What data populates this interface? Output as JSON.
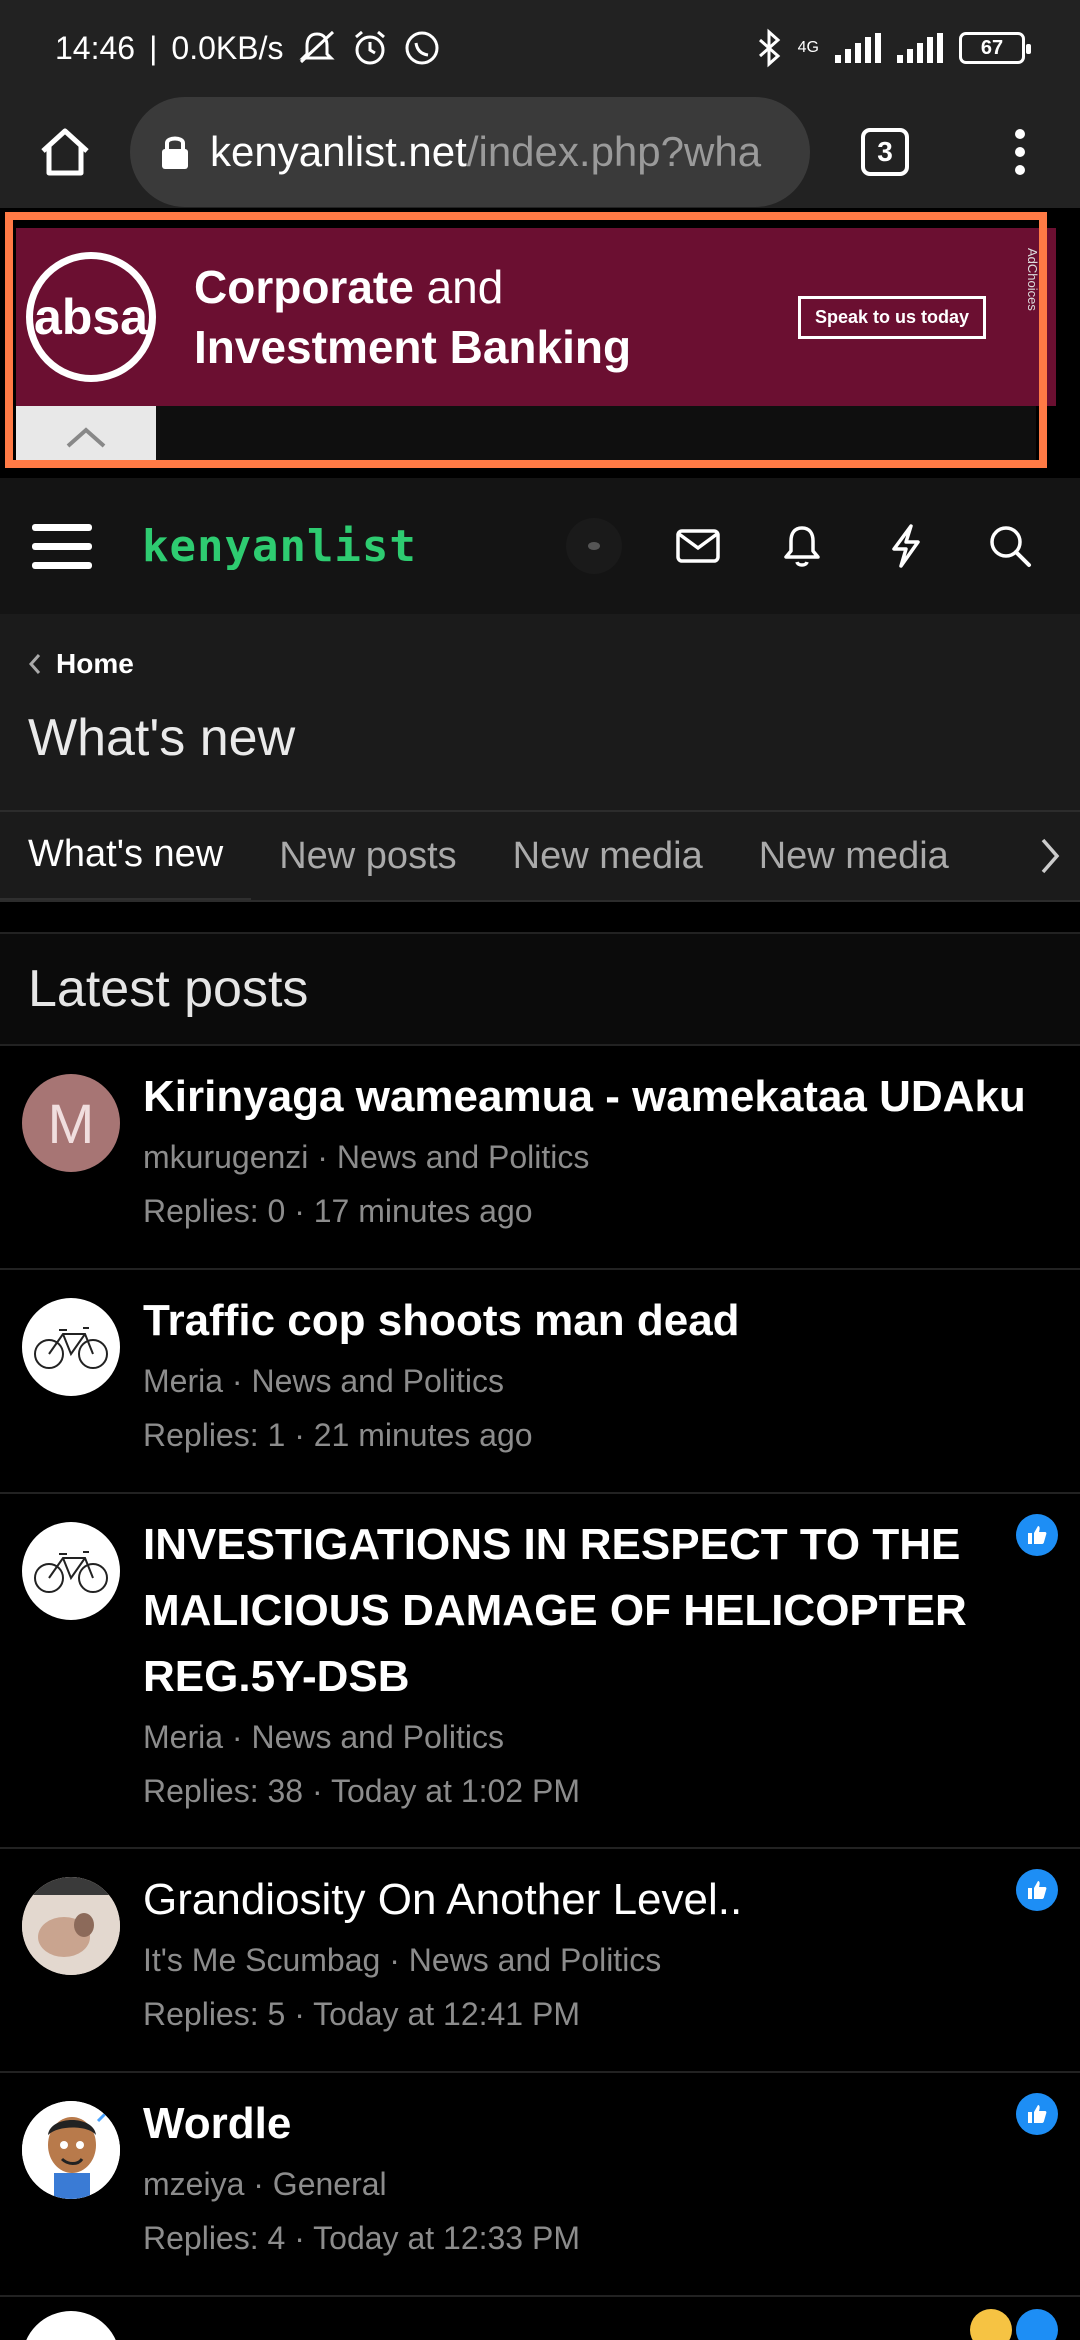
{
  "status_bar": {
    "time": "14:46",
    "speed": "0.0KB/s",
    "network": "4G",
    "battery": "67"
  },
  "browser": {
    "url_host": "kenyanlist.net",
    "url_path": "/index.php?wha",
    "tab_count": "3"
  },
  "ad": {
    "brand": "absa",
    "line1_bold": "Corporate",
    "line1_light": " and",
    "line2": "Investment Banking",
    "cta": "Speak to us today",
    "tag": "AdChoices"
  },
  "site": {
    "logo": "kenyanlist"
  },
  "breadcrumb": {
    "home": "Home"
  },
  "page_title": "What's new",
  "tabs": [
    "What's new",
    "New posts",
    "New media",
    "New media"
  ],
  "section_title": "Latest posts",
  "posts": [
    {
      "title": "Kirinyaga wameamua - wamekataa UDAku",
      "author": "mkurugenzi",
      "forum": "News and Politics",
      "replies": "Replies: 0",
      "time": "17 minutes ago",
      "avatar_letter": "M"
    },
    {
      "title": "Traffic cop shoots man dead",
      "author": "Meria",
      "forum": "News and Politics",
      "replies": "Replies: 1",
      "time": "21 minutes ago"
    },
    {
      "title": "INVESTIGATIONS IN RESPECT TO THE MALICIOUS DAMAGE OF HELICOPTER REG.5Y-DSB",
      "author": "Meria",
      "forum": "News and Politics",
      "replies": "Replies: 38",
      "time": "Today at 1:02 PM"
    },
    {
      "title": "Grandiosity On Another Level..",
      "author": "It's Me Scumbag",
      "forum": "News and Politics",
      "replies": "Replies: 5",
      "time": "Today at 12:41 PM"
    },
    {
      "title": "Wordle",
      "author": "mzeiya",
      "forum": "General",
      "replies": "Replies: 4",
      "time": "Today at 12:33 PM"
    }
  ],
  "colors": {
    "accent_orange": "#ff7a45",
    "ad_maroon": "#6b0f31",
    "logo_green": "#2ecc71",
    "like_blue": "#1d8ef5"
  }
}
